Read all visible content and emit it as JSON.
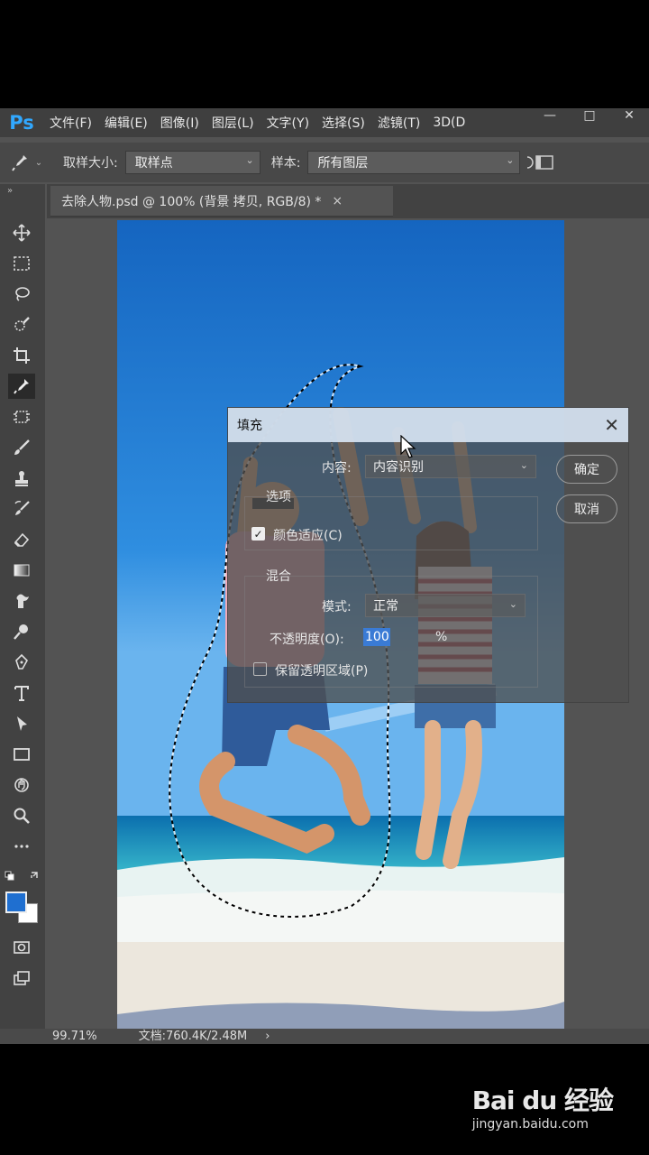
{
  "app": {
    "logo": "Ps"
  },
  "menu": [
    "文件(F)",
    "编辑(E)",
    "图像(I)",
    "图层(L)",
    "文字(Y)",
    "选择(S)",
    "滤镜(T)",
    "3D(D"
  ],
  "window_controls": [
    "—",
    "□",
    "✕"
  ],
  "options": {
    "sample_size_label": "取样大小:",
    "sample_size_value": "取样点",
    "sample_label": "样本:",
    "sample_value": "所有图层"
  },
  "document": {
    "tab_title": "去除人物.psd @ 100% (背景 拷贝, RGB/8) *",
    "close": "×"
  },
  "dialog": {
    "title": "填充",
    "close": "✕",
    "content_label": "内容:",
    "content_value": "内容识别",
    "options_group": "选项",
    "color_adapt_label": "颜色适应(C)",
    "color_adapt_checked": true,
    "blend_group": "混合",
    "mode_label": "模式:",
    "mode_value": "正常",
    "opacity_label": "不透明度(O):",
    "opacity_value": "100",
    "opacity_unit": "%",
    "preserve_label": "保留透明区域(P)",
    "preserve_checked": false,
    "ok_label": "确定",
    "cancel_label": "取消"
  },
  "status": {
    "zoom": "99.71%",
    "doc_info": "文档:760.4K/2.48M",
    "arrow": "›"
  },
  "watermark": {
    "brand": "Bai du 经验",
    "url": "jingyan.baidu.com"
  },
  "colors": {
    "foreground": "#1f6fd0",
    "background": "#ffffff",
    "accent": "#31a8ff"
  },
  "tools": [
    "move-icon",
    "marquee-icon",
    "lasso-icon",
    "quick-select-icon",
    "crop-icon",
    "eyedropper-icon",
    "frame-icon",
    "brush-icon",
    "stamp-icon",
    "history-brush-icon",
    "eraser-icon",
    "gradient-icon",
    "smudge-icon",
    "dodge-icon",
    "pen-icon",
    "type-icon",
    "path-select-icon",
    "rectangle-icon",
    "hand-rotate-icon",
    "zoom-icon",
    "more-icon"
  ]
}
